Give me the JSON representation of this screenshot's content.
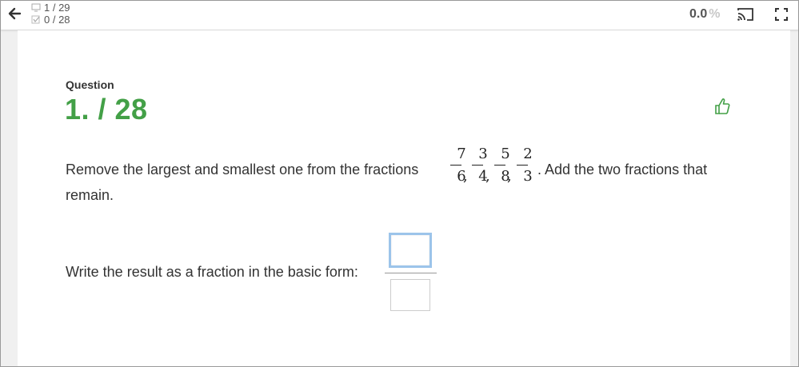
{
  "topbar": {
    "questions_progress": "1 / 29",
    "answered_progress": "0 / 28",
    "score_value": "0.0",
    "score_unit": "%"
  },
  "question": {
    "label": "Question",
    "number": "1. / 28",
    "text_before": "Remove the largest and smallest one from the fractions",
    "text_after": ". Add the two fractions that",
    "text_line2": "remain.",
    "fractions": [
      {
        "num": "7",
        "den": "6"
      },
      {
        "num": "3",
        "den": "4"
      },
      {
        "num": "5",
        "den": "8"
      },
      {
        "num": "2",
        "den": "3"
      }
    ],
    "separator": ",",
    "prompt": "Write the result as a fraction in the basic form:"
  },
  "answer": {
    "numerator_value": "",
    "denominator_value": ""
  },
  "colors": {
    "accent_green": "#43a047",
    "input_focus_border": "#9cc4ea"
  }
}
